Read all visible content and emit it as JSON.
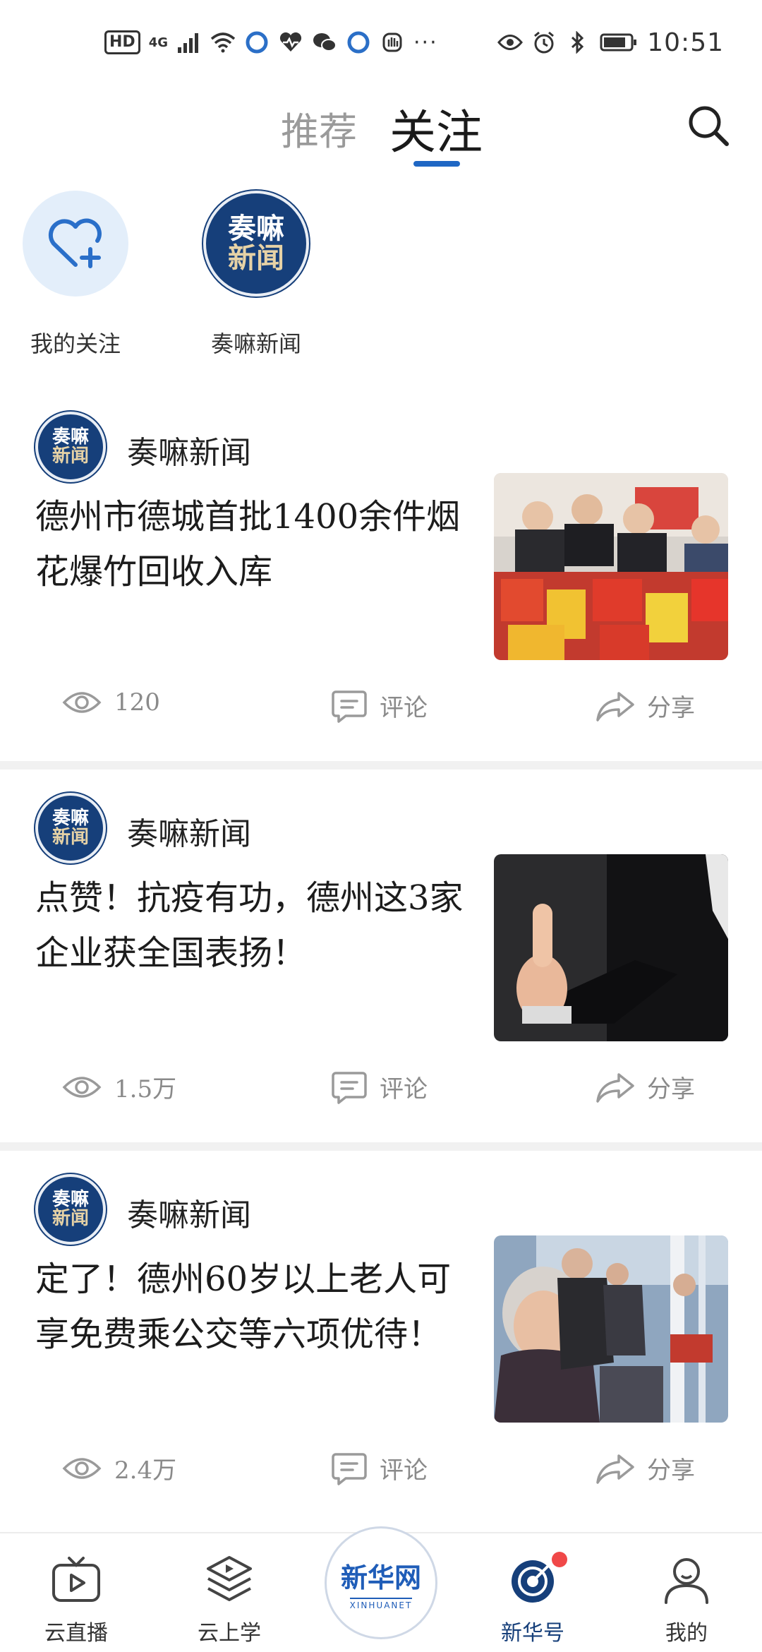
{
  "status_bar": {
    "hd": "HD",
    "network": "4G",
    "time": "10:51",
    "more": "···"
  },
  "top_tabs": {
    "recommend": "推荐",
    "follow": "关注",
    "active": "关注"
  },
  "follow_row": {
    "my_follow_label": "我的关注",
    "account_label": "奏嘛新闻",
    "logo_line1": "奏嘛",
    "logo_line2": "新闻"
  },
  "feed": [
    {
      "source": "奏嘛新闻",
      "title": "德州市德城首批1400余件烟花爆竹回收入库",
      "views": "120",
      "comment_label": "评论",
      "share_label": "分享"
    },
    {
      "source": "奏嘛新闻",
      "title": "点赞！抗疫有功，德州这3家企业获全国表扬！",
      "views": "1.5万",
      "comment_label": "评论",
      "share_label": "分享"
    },
    {
      "source": "奏嘛新闻",
      "title": "定了！德州60岁以上老人可享免费乘公交等六项优待！",
      "views": "2.4万",
      "comment_label": "评论",
      "share_label": "分享"
    }
  ],
  "bottom_nav": {
    "live": "云直播",
    "learn": "云上学",
    "center_brand": "新华网",
    "center_sub": "XINHUANET",
    "xinhuahao": "新华号",
    "mine": "我的"
  },
  "colors": {
    "accent": "#1f67c4",
    "logo_navy": "#163f7a",
    "logo_gold": "#e6d2a6",
    "muted_text": "#8a8a8a",
    "notify_dot": "#f04848"
  }
}
